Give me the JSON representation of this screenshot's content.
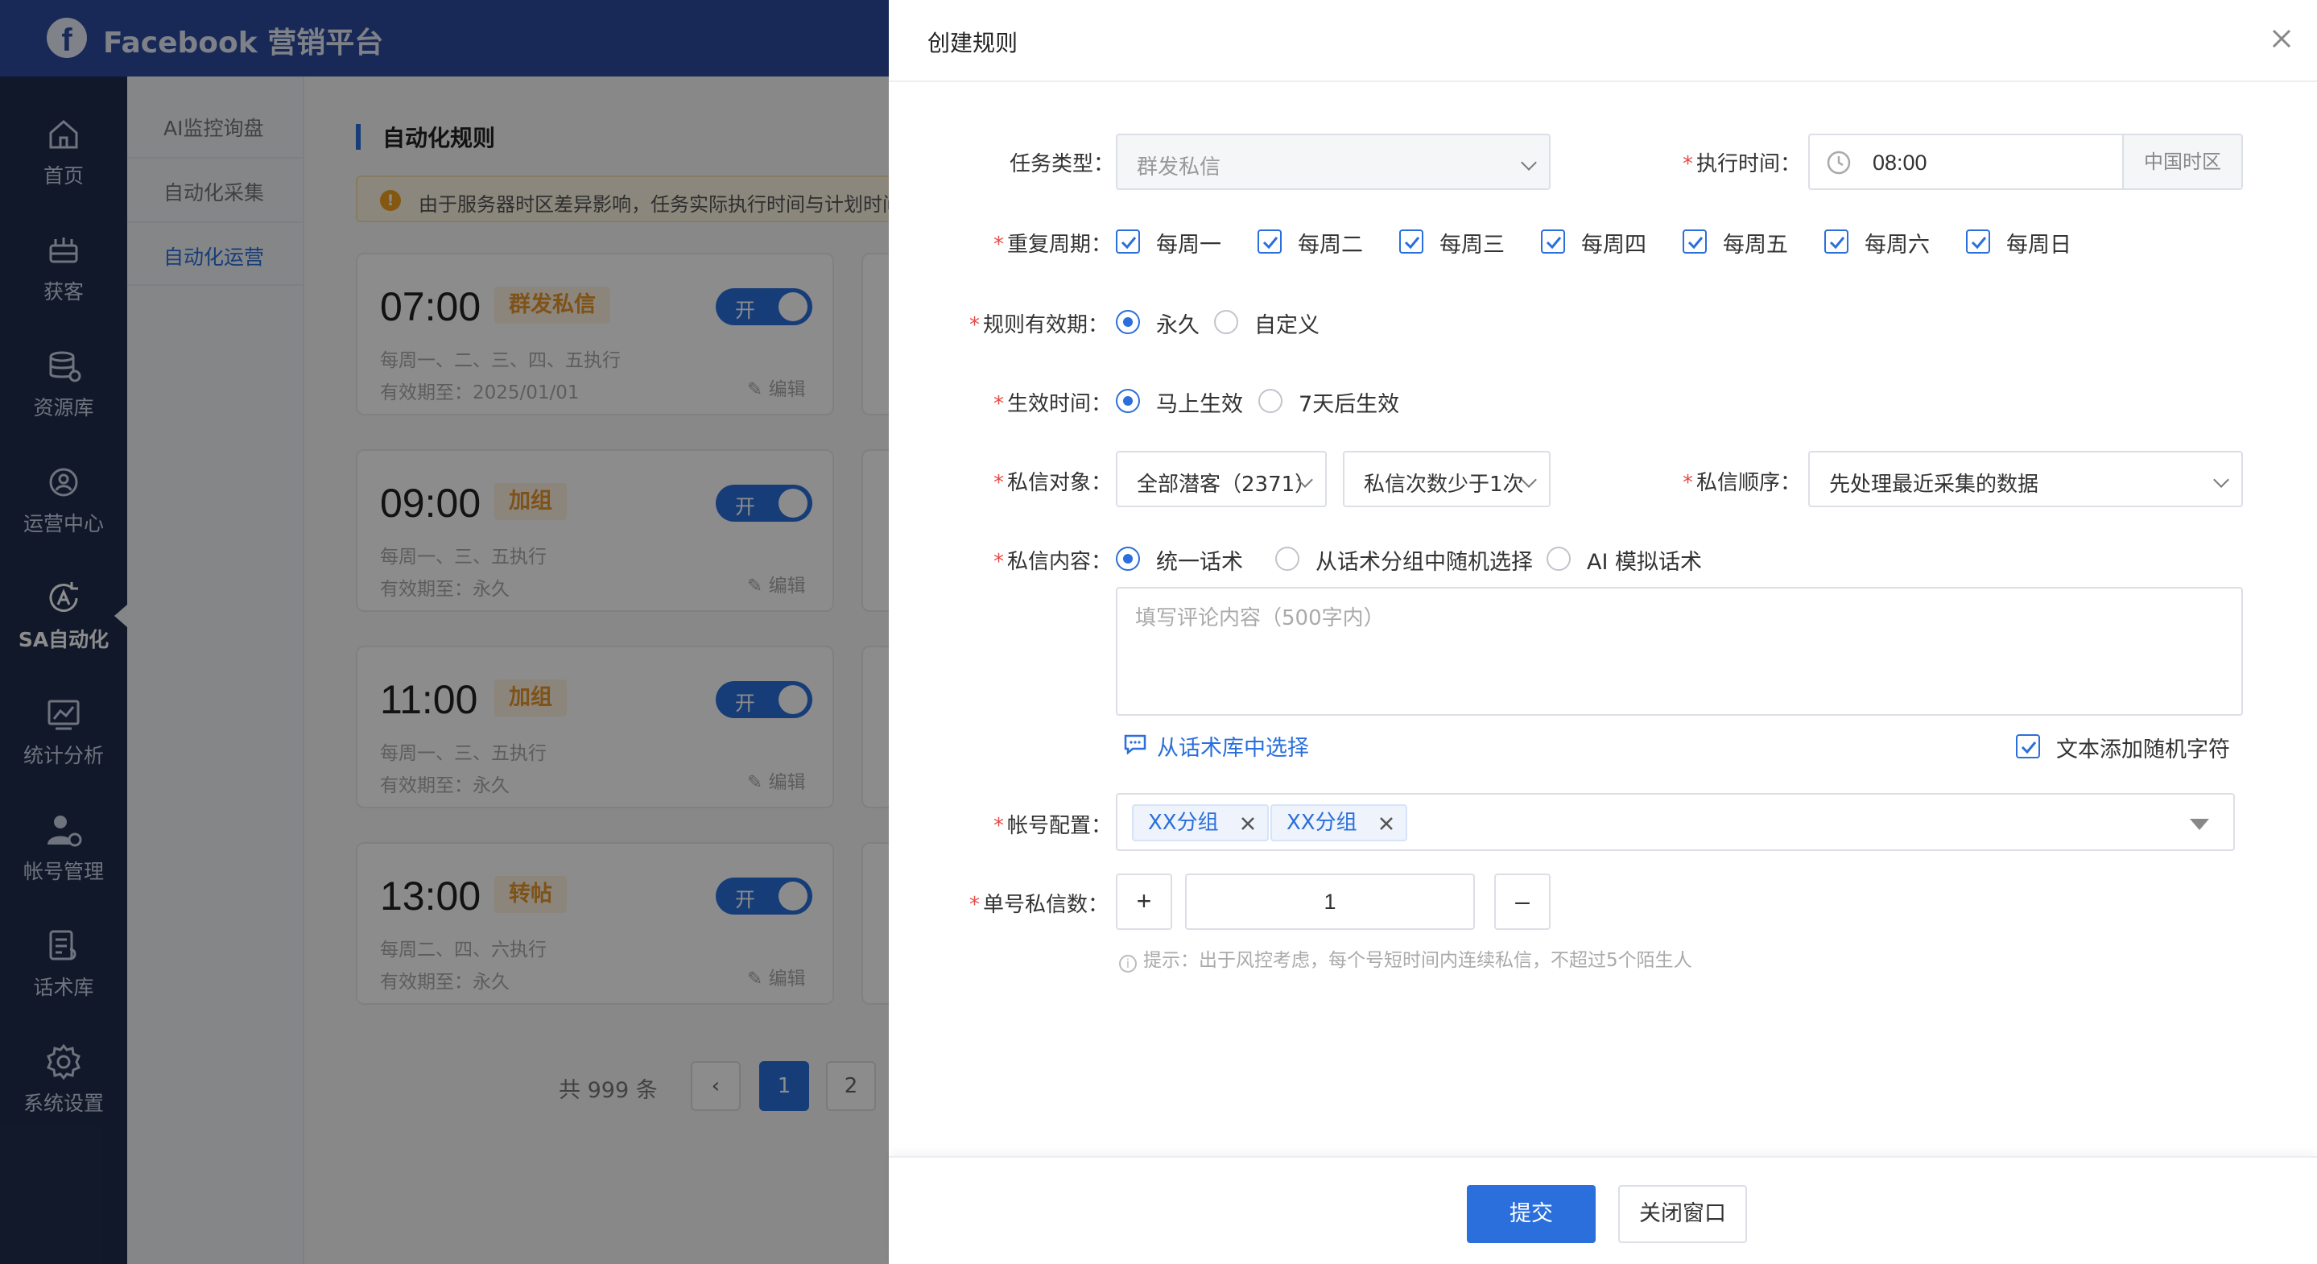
{
  "app": {
    "brand": "Facebook 营销平台"
  },
  "sidenav": [
    {
      "label": "首页",
      "icon": "home-icon"
    },
    {
      "label": "获客",
      "icon": "acquire-icon"
    },
    {
      "label": "资源库",
      "icon": "database-icon"
    },
    {
      "label": "运营中心",
      "icon": "operations-icon"
    },
    {
      "label": "SA自动化",
      "icon": "automation-icon",
      "active": true
    },
    {
      "label": "统计分析",
      "icon": "chart-icon"
    },
    {
      "label": "帐号管理",
      "icon": "user-settings-icon"
    },
    {
      "label": "话术库",
      "icon": "script-icon"
    },
    {
      "label": "系统设置",
      "icon": "gear-icon"
    }
  ],
  "subnav": [
    {
      "label": "AI监控询盘"
    },
    {
      "label": "自动化采集"
    },
    {
      "label": "自动化运营",
      "active": true
    }
  ],
  "page": {
    "title": "自动化规则",
    "notice": "由于服务器时区差异影响，任务实际执行时间与计划时间"
  },
  "rules": [
    {
      "time": "07:00",
      "tag": "群发私信",
      "toggle": "开",
      "schedule": "每周一、二、三、四、五执行",
      "valid": "有效期至：2025/01/01",
      "edit": "编辑"
    },
    {
      "time": "09:00",
      "tag": "加组",
      "toggle": "开",
      "schedule": "每周一、三、五执行",
      "valid": "有效期至：永久",
      "edit": "编辑"
    },
    {
      "time": "11:00",
      "tag": "加组",
      "toggle": "开",
      "schedule": "每周一、三、五执行",
      "valid": "有效期至：永久",
      "edit": "编辑"
    },
    {
      "time": "13:00",
      "tag": "转帖",
      "toggle": "开",
      "schedule": "每周二、四、六执行",
      "valid": "有效期至：永久",
      "edit": "编辑"
    }
  ],
  "pager": {
    "total": "共 999 条",
    "prev": "‹",
    "pages": [
      "1",
      "2"
    ]
  },
  "drawer": {
    "title": "创建规则",
    "task_type": {
      "label": "任务类型：",
      "value": "群发私信"
    },
    "exec_time": {
      "label": "执行时间：",
      "value": "08:00",
      "timezone": "中国时区"
    },
    "repeat": {
      "label": "重复周期：",
      "days": [
        "每周一",
        "每周二",
        "每周三",
        "每周四",
        "每周五",
        "每周六",
        "每周日"
      ]
    },
    "validity": {
      "label": "规则有效期：",
      "options": [
        "永久",
        "自定义"
      ]
    },
    "effective": {
      "label": "生效时间：",
      "options": [
        "马上生效",
        "7天后生效"
      ]
    },
    "target": {
      "label": "私信对象：",
      "value1": "全部潜客（2371）",
      "value2": "私信次数少于1次"
    },
    "order": {
      "label": "私信顺序：",
      "value": "先处理最近采集的数据"
    },
    "content": {
      "label": "私信内容：",
      "options": [
        "统一话术",
        "从话术分组中随机选择",
        "AI 模拟话术"
      ],
      "placeholder": "填写评论内容（500字内）",
      "library_link": "从话术库中选择",
      "random_char": "文本添加随机字符"
    },
    "accounts": {
      "label": "帐号配置：",
      "chips": [
        "XX分组",
        "XX分组"
      ]
    },
    "per_account": {
      "label": "单号私信数：",
      "plus": "+",
      "value": "1",
      "minus": "–",
      "hint": "提示：出于风控考虑，每个号短时间内连续私信，不超过5个陌生人"
    },
    "submit": "提交",
    "close": "关闭窗口"
  },
  "colors": {
    "primary": "#2a6fdb",
    "topbar": "#2c4b9f",
    "sidenav": "#1f2d4d",
    "tag": "#e8962a"
  }
}
